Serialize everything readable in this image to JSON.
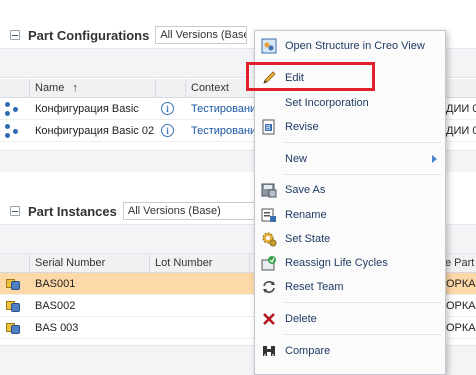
{
  "configurations": {
    "title": "Part Configurations",
    "version_filter": "All Versions (Base)",
    "columns": {
      "name": "Name",
      "sort_indicator": "↑",
      "context": "Context"
    },
    "rows": [
      {
        "name": "Конфигурация Basic",
        "info": "i",
        "context": "Тестировани",
        "trail": "ДИИ 0."
      },
      {
        "name": "Конфигурация Basic 02",
        "info": "i",
        "context": "Тестировани",
        "trail": "ДИИ 0."
      }
    ]
  },
  "instances": {
    "title": "Part Instances",
    "version_filter": "All Versions (Base)",
    "columns": {
      "serial": "Serial Number",
      "lot": "Lot Number",
      "part": "e Part"
    },
    "rows": [
      {
        "serial": "BAS001",
        "trail": "ОРКА ,",
        "selected": true
      },
      {
        "serial": "BAS002",
        "trail": "ОРКА ,",
        "selected": false
      },
      {
        "serial": "BAS 003",
        "trail": "ОРКА ,",
        "selected": false
      }
    ]
  },
  "context_menu": {
    "items": {
      "open_creo": "Open Structure in Creo View",
      "edit": "Edit",
      "set_incorporation": "Set Incorporation",
      "revise": "Revise",
      "new": "New",
      "save_as": "Save As",
      "rename": "Rename",
      "set_state": "Set State",
      "reassign": "Reassign Life Cycles",
      "reset_team": "Reset Team",
      "delete": "Delete",
      "compare": "Compare"
    },
    "highlight_color": "#e0212b"
  }
}
